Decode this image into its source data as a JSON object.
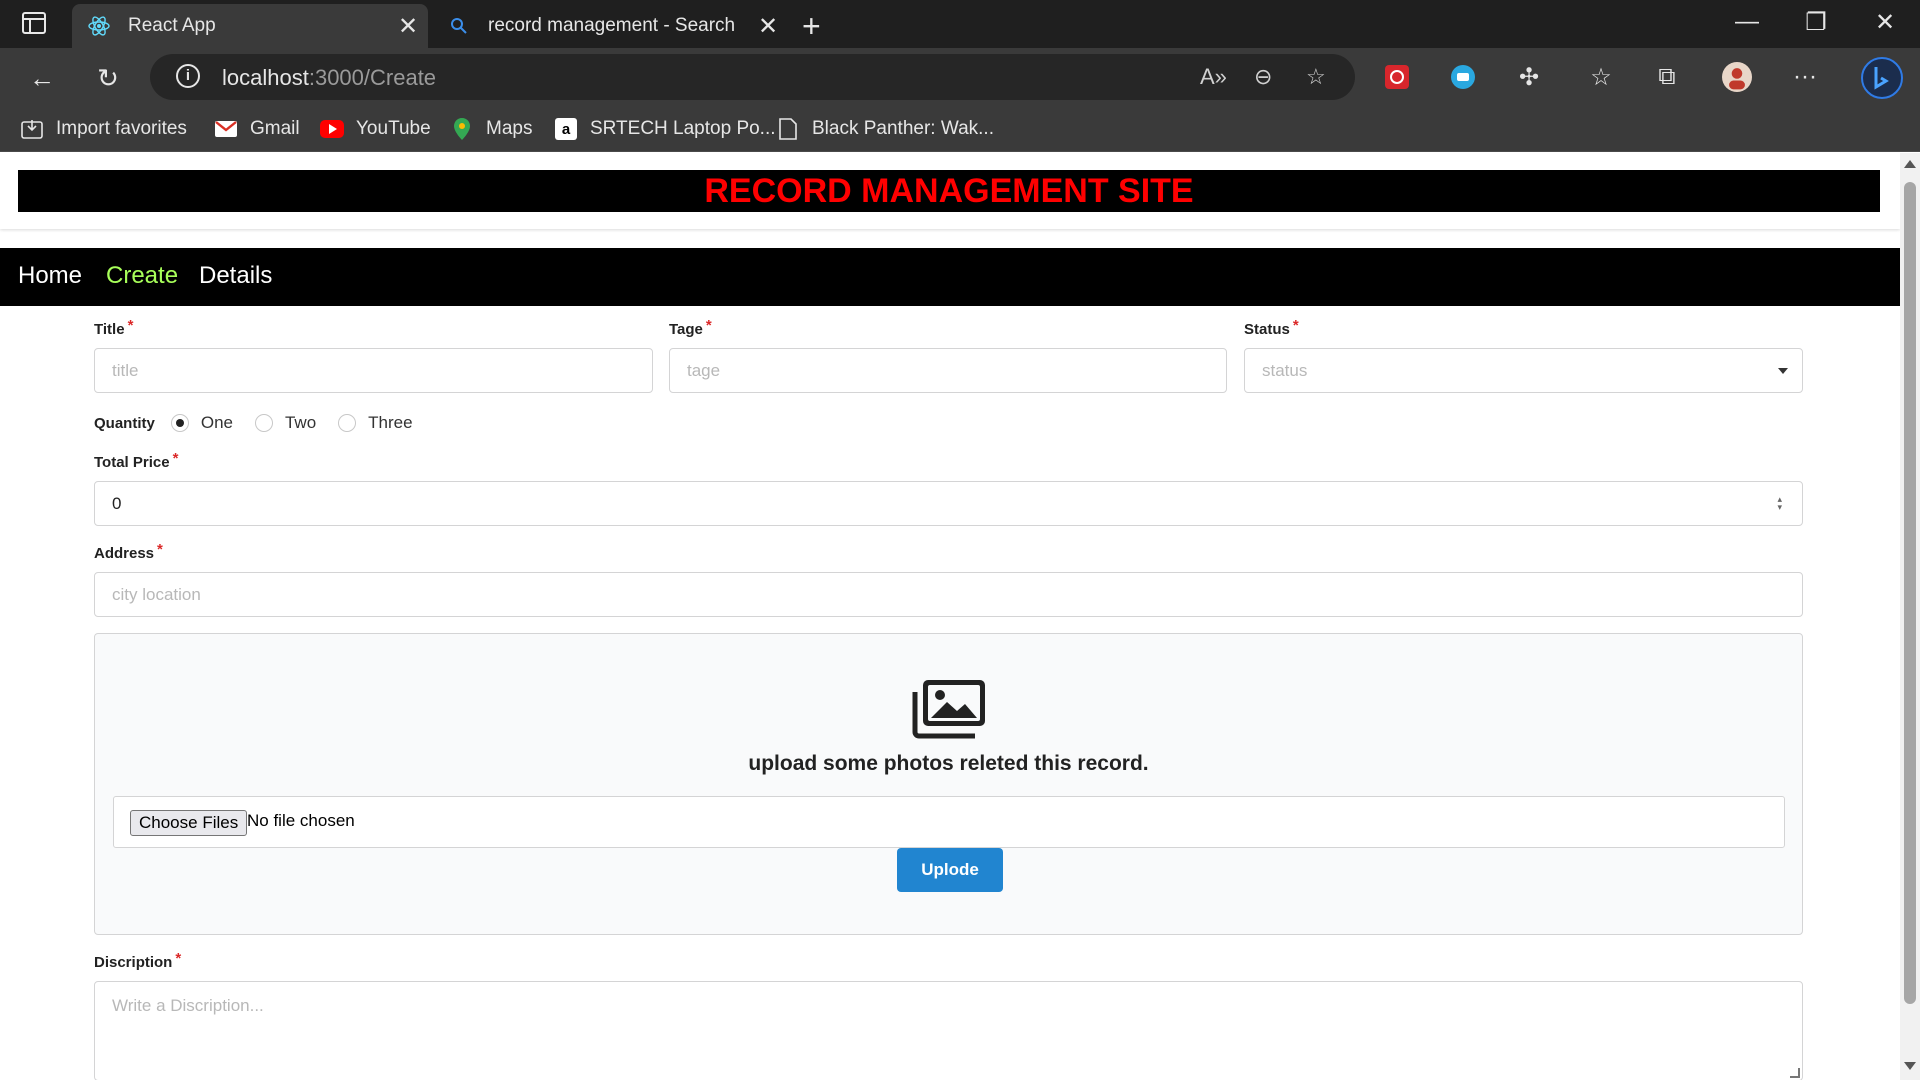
{
  "browser": {
    "tabs": [
      {
        "title": "React App",
        "icon": "react-icon",
        "active": true
      },
      {
        "title": "record management - Search",
        "icon": "search-icon",
        "active": false
      }
    ],
    "address": {
      "host": "localhost",
      "path": ":3000/Create"
    },
    "bookmarks": [
      {
        "label": "Import favorites",
        "icon": "import-icon"
      },
      {
        "label": "Gmail",
        "icon": "gmail-icon"
      },
      {
        "label": "YouTube",
        "icon": "youtube-icon"
      },
      {
        "label": "Maps",
        "icon": "maps-icon"
      },
      {
        "label": "SRTECH Laptop Po...",
        "icon": "amazon-icon"
      },
      {
        "label": "Black Panther: Wak...",
        "icon": "page-icon"
      }
    ],
    "accent_color": "#3a3a3a"
  },
  "site": {
    "title": "RECORD MANAGEMENT SITE",
    "title_color": "#ff0000"
  },
  "nav": {
    "items": [
      {
        "label": "Home",
        "active": false
      },
      {
        "label": "Create",
        "active": true
      },
      {
        "label": "Details",
        "active": false
      }
    ],
    "active_color": "#a8ff5a"
  },
  "form": {
    "title": {
      "label": "Title",
      "placeholder": "title"
    },
    "tage": {
      "label": "Tage",
      "placeholder": "tage"
    },
    "status": {
      "label": "Status",
      "placeholder": "status"
    },
    "quantity": {
      "label": "Quantity",
      "options": [
        "One",
        "Two",
        "Three"
      ],
      "selected": "One"
    },
    "total_price": {
      "label": "Total Price",
      "value": "0"
    },
    "address": {
      "label": "Address",
      "placeholder": "city location"
    },
    "upload": {
      "text": "upload some photos releted this record.",
      "choose_label": "Choose Files",
      "file_status": "No file chosen",
      "button_label": "Uplode"
    },
    "description": {
      "label": "Discription",
      "placeholder": "Write a Discription..."
    },
    "required_mark": "*"
  }
}
